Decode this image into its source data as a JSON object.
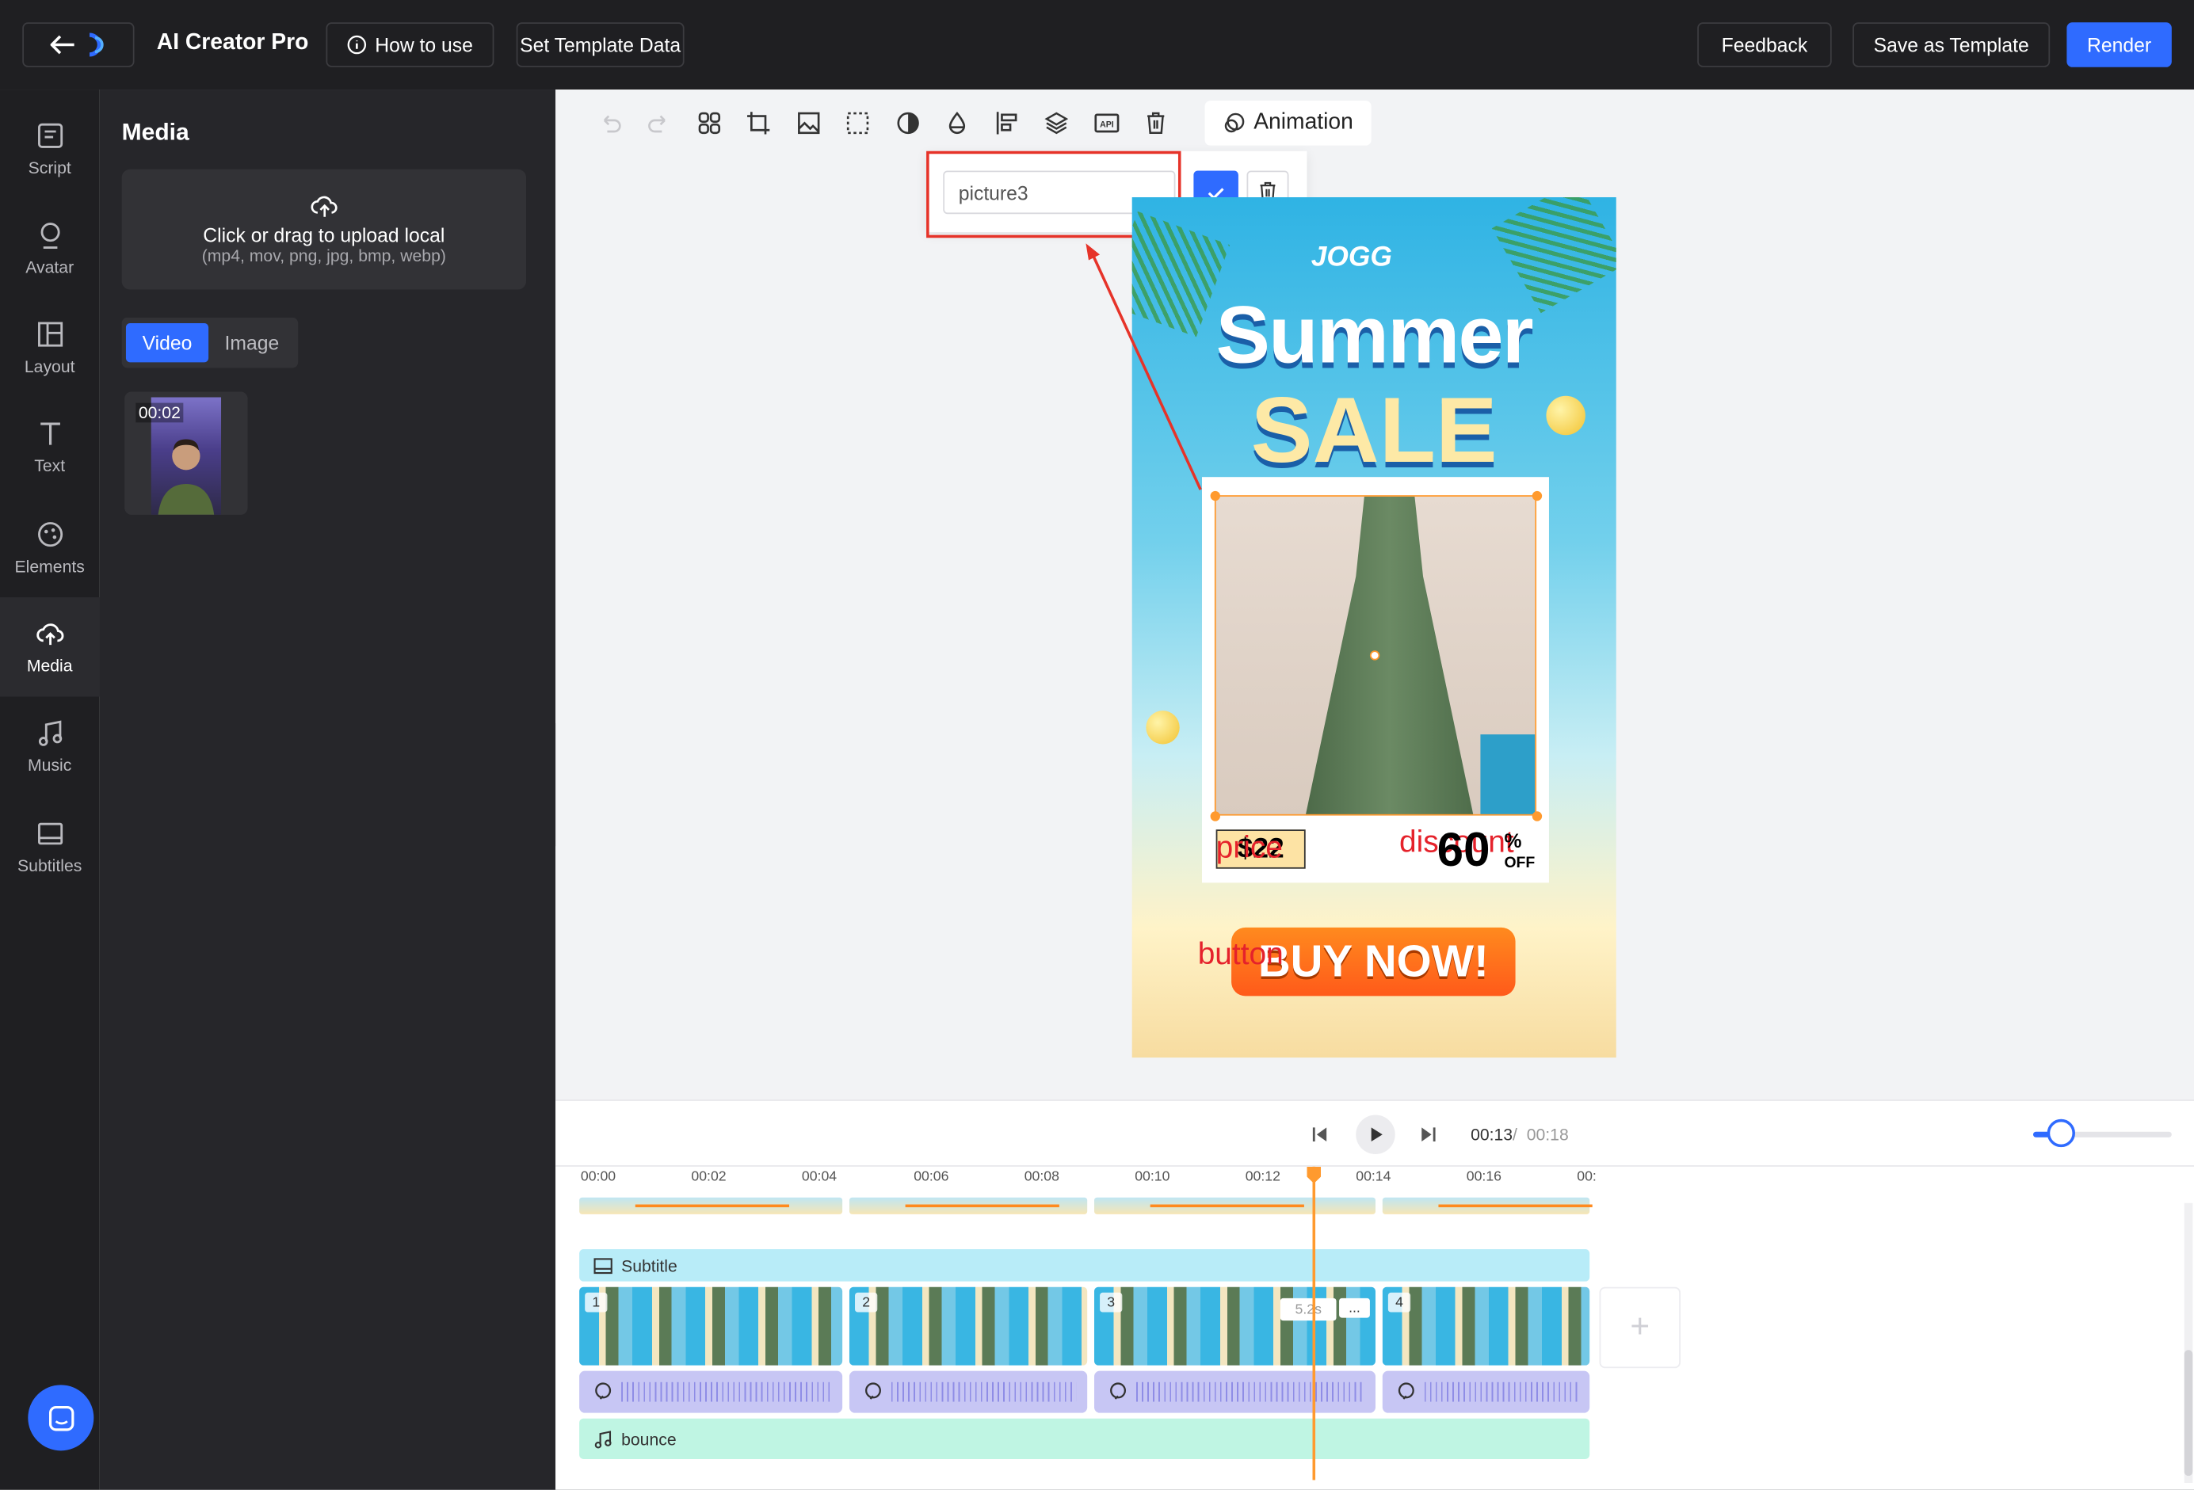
{
  "header": {
    "back_icon": "arrow-left-icon",
    "app_title": "AI Creator Pro",
    "how_to_use": "How to use",
    "set_template_data": "Set Template Data",
    "feedback": "Feedback",
    "save_as_template": "Save as Template",
    "render": "Render",
    "accent_color": "#2f6bff"
  },
  "nav": {
    "items": [
      {
        "label": "Script",
        "icon": "script-icon"
      },
      {
        "label": "Avatar",
        "icon": "avatar-icon"
      },
      {
        "label": "Layout",
        "icon": "layout-icon"
      },
      {
        "label": "Text",
        "icon": "text-icon"
      },
      {
        "label": "Elements",
        "icon": "elements-icon"
      },
      {
        "label": "Media",
        "icon": "cloud-upload-icon",
        "active": true
      },
      {
        "label": "Music",
        "icon": "music-icon"
      },
      {
        "label": "Subtitles",
        "icon": "subtitles-icon"
      }
    ]
  },
  "media": {
    "title": "Media",
    "upload_main": "Click or drag to upload local",
    "upload_sub": "(mp4, mov, png, jpg, bmp, webp)",
    "tabs": [
      "Video",
      "Image"
    ],
    "selected_tab": "Video",
    "items": [
      {
        "duration": "00:02"
      }
    ]
  },
  "toolbar": {
    "tools": [
      "undo-icon",
      "redo-icon",
      "group-icon",
      "crop-icon",
      "replace-image-icon",
      "mask-icon",
      "adjust-icon",
      "color-drop-icon",
      "align-icon",
      "layers-icon",
      "api-icon",
      "delete-icon"
    ],
    "animation": "Animation"
  },
  "rename_popup": {
    "value": "picture3"
  },
  "poster": {
    "logo": "JOGG",
    "headline1": "Summer",
    "headline2": "SALE",
    "price": "$22",
    "price_label": "price",
    "discount_label": "discount",
    "discount_value": "60",
    "percent": "%",
    "off": "OFF",
    "button_label": "button",
    "buy_now": "BUY NOW!"
  },
  "playback": {
    "current_time": "00:13",
    "separator": "/",
    "total_time": "00:18",
    "zoom_level": 0.2
  },
  "timeline": {
    "ruler": [
      "00:00",
      "00:02",
      "00:04",
      "00:06",
      "00:08",
      "00:10",
      "00:12",
      "00:14",
      "00:16",
      "00:"
    ],
    "subtitle_track": "Subtitle",
    "scenes": [
      "1",
      "2",
      "3",
      "4"
    ],
    "scene_duration": "5.2s",
    "more": "...",
    "music_track": "bounce",
    "add_scene": "+"
  }
}
